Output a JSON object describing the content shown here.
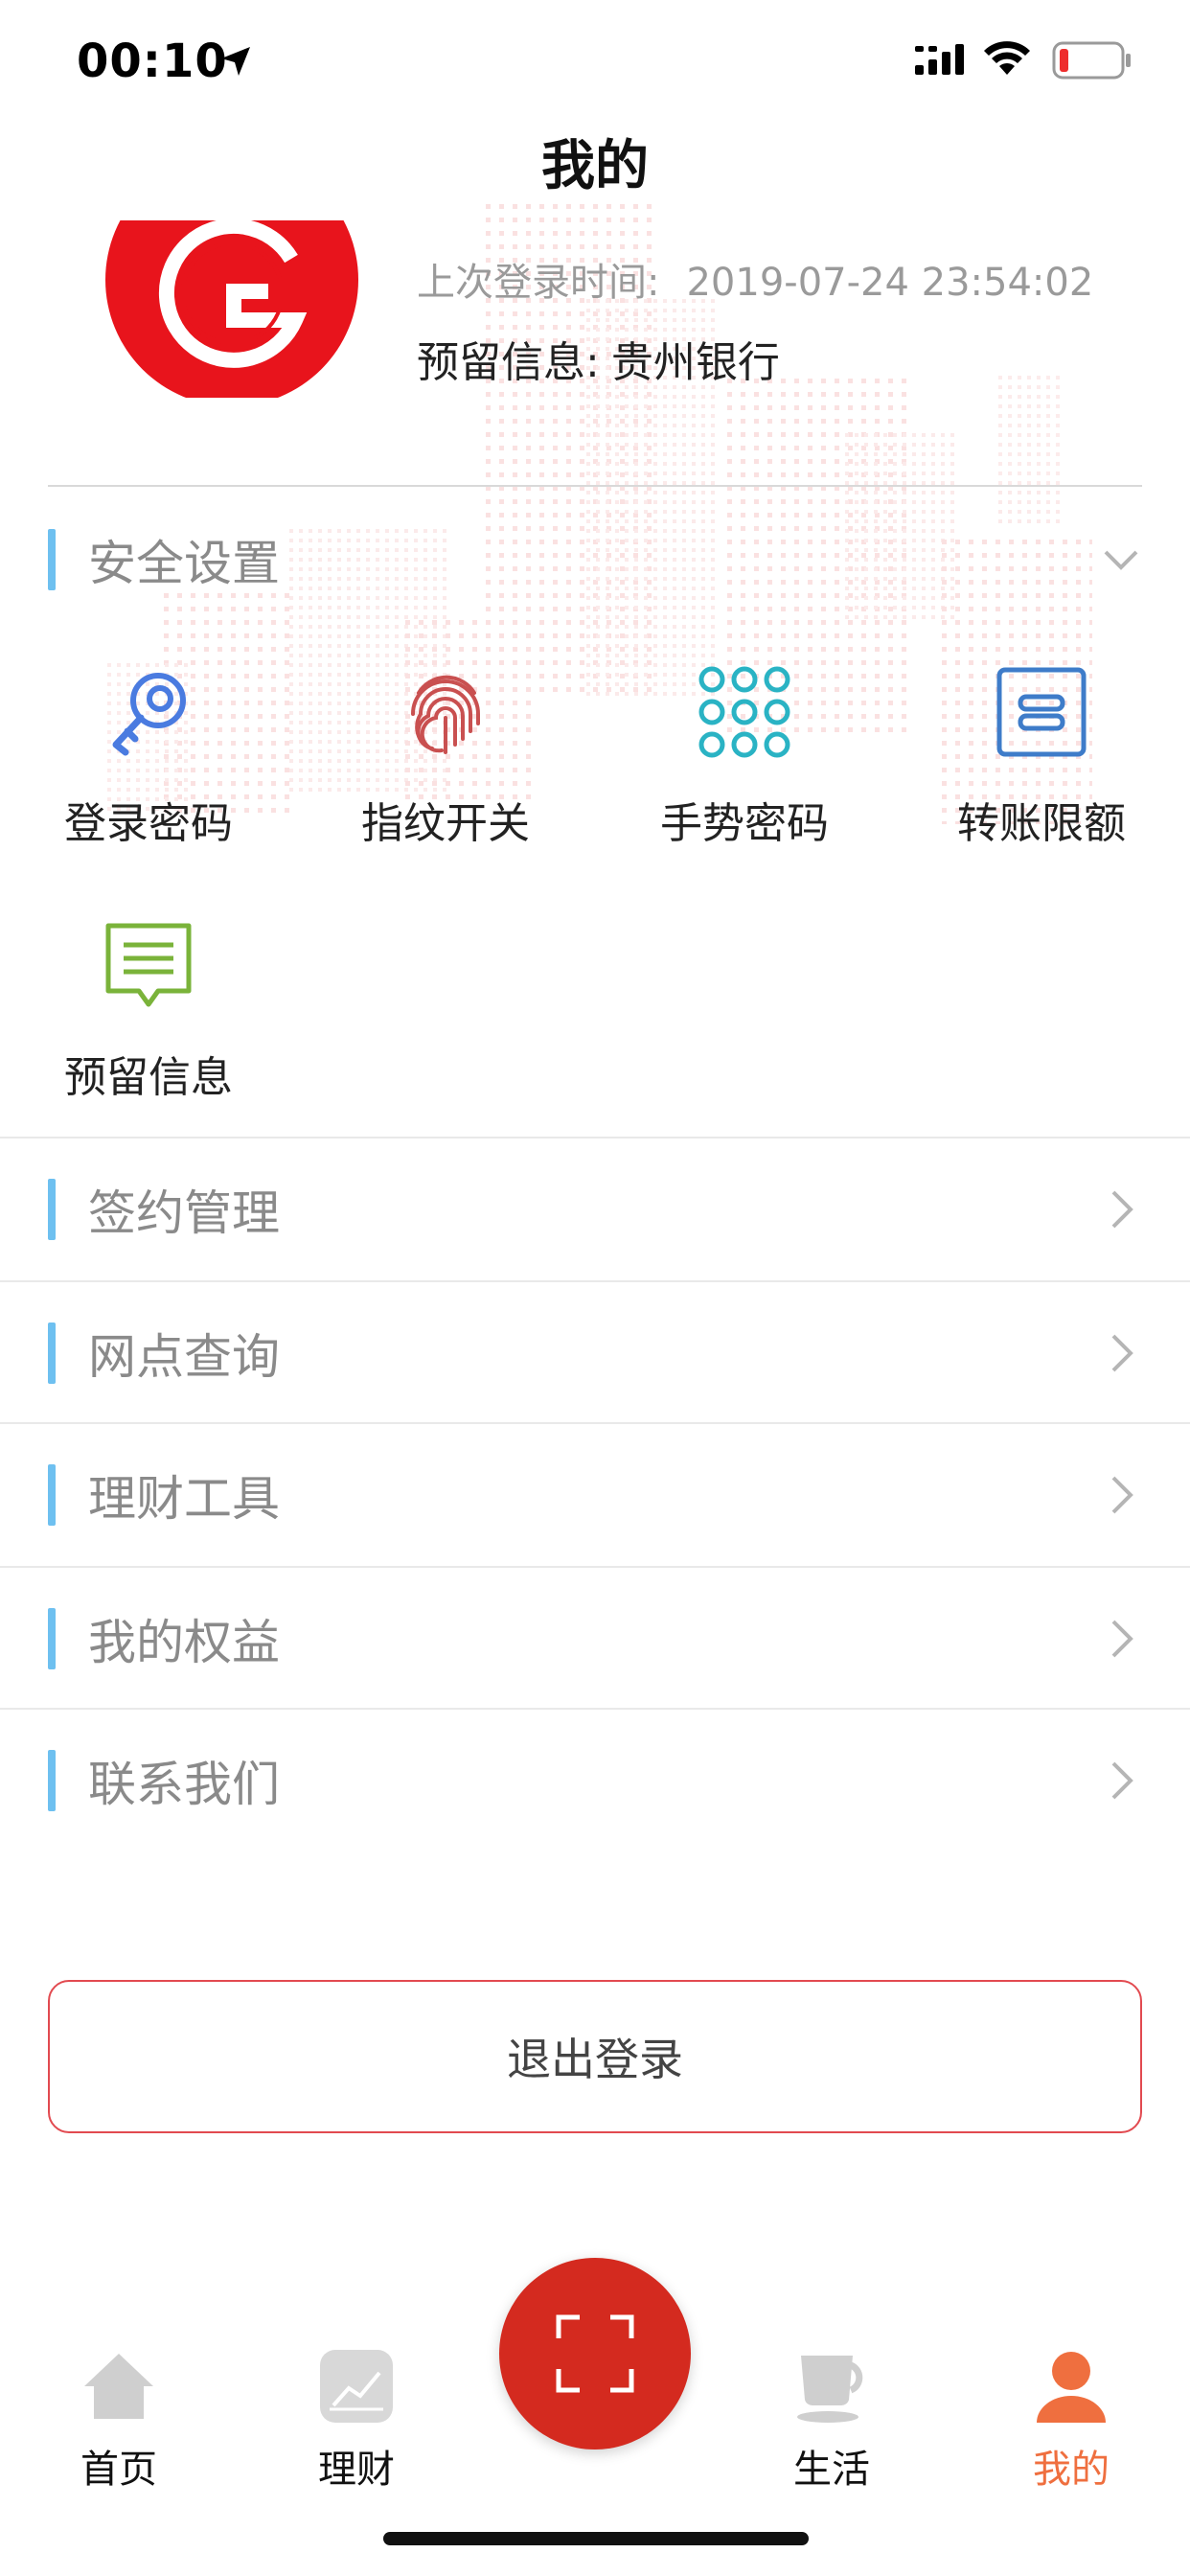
{
  "status_bar": {
    "time": "00:10",
    "icons": [
      "location-arrow-icon",
      "signal-icon",
      "wifi-icon",
      "battery-low-icon"
    ]
  },
  "nav": {
    "title": "我的"
  },
  "profile": {
    "last_login_label": "上次登录时间:",
    "last_login_value": "2019-07-24 23:54:02",
    "reserved_label": "预留信息:",
    "reserved_value": "贵州银行"
  },
  "security": {
    "title": "安全设置",
    "items": [
      {
        "label": "登录密码",
        "icon": "key-icon",
        "color": "#4a7be0"
      },
      {
        "label": "指纹开关",
        "icon": "fingerprint-icon",
        "color": "#c95050"
      },
      {
        "label": "手势密码",
        "icon": "gesture-grid-icon",
        "color": "#2ab3c4"
      },
      {
        "label": "转账限额",
        "icon": "transfer-limit-icon",
        "color": "#3e7cc9"
      },
      {
        "label": "预留信息",
        "icon": "message-icon",
        "color": "#7ab33a"
      }
    ]
  },
  "menu": [
    {
      "label": "签约管理"
    },
    {
      "label": "网点查询"
    },
    {
      "label": "理财工具"
    },
    {
      "label": "我的权益"
    },
    {
      "label": "联系我们"
    }
  ],
  "logout": {
    "label": "退出登录"
  },
  "tabs": [
    {
      "label": "首页",
      "icon": "home-icon"
    },
    {
      "label": "理财",
      "icon": "chart-icon"
    },
    {
      "label": "",
      "icon": "scan-icon"
    },
    {
      "label": "生活",
      "icon": "coffee-cup-icon"
    },
    {
      "label": "我的",
      "icon": "user-icon",
      "active": true
    }
  ],
  "colors": {
    "accent_blue": "#6ec0f0",
    "logout_border": "#e24a50",
    "scan_button": "#d42a1f",
    "active_tab": "#ef6f3f"
  }
}
